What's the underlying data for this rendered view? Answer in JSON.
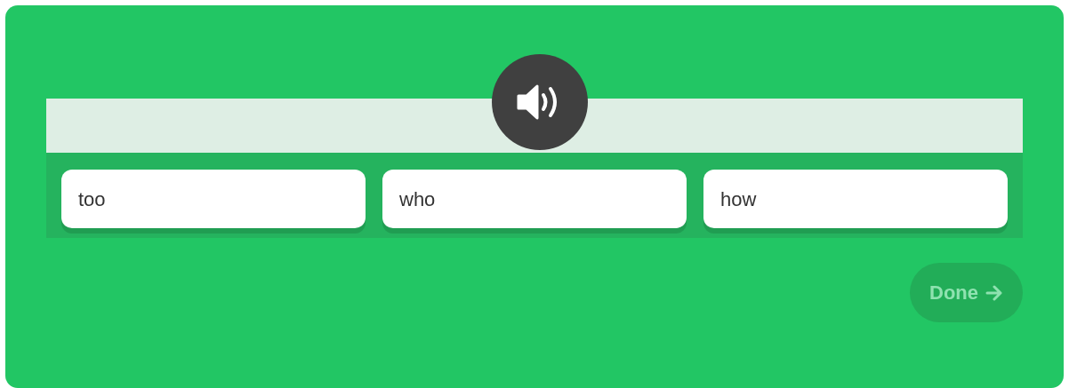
{
  "word_choices": [
    {
      "label": "too",
      "selected": false
    },
    {
      "label": "who",
      "selected": false
    },
    {
      "label": "how",
      "selected": false
    }
  ],
  "done_button": {
    "label": "Done",
    "disabled": true
  }
}
